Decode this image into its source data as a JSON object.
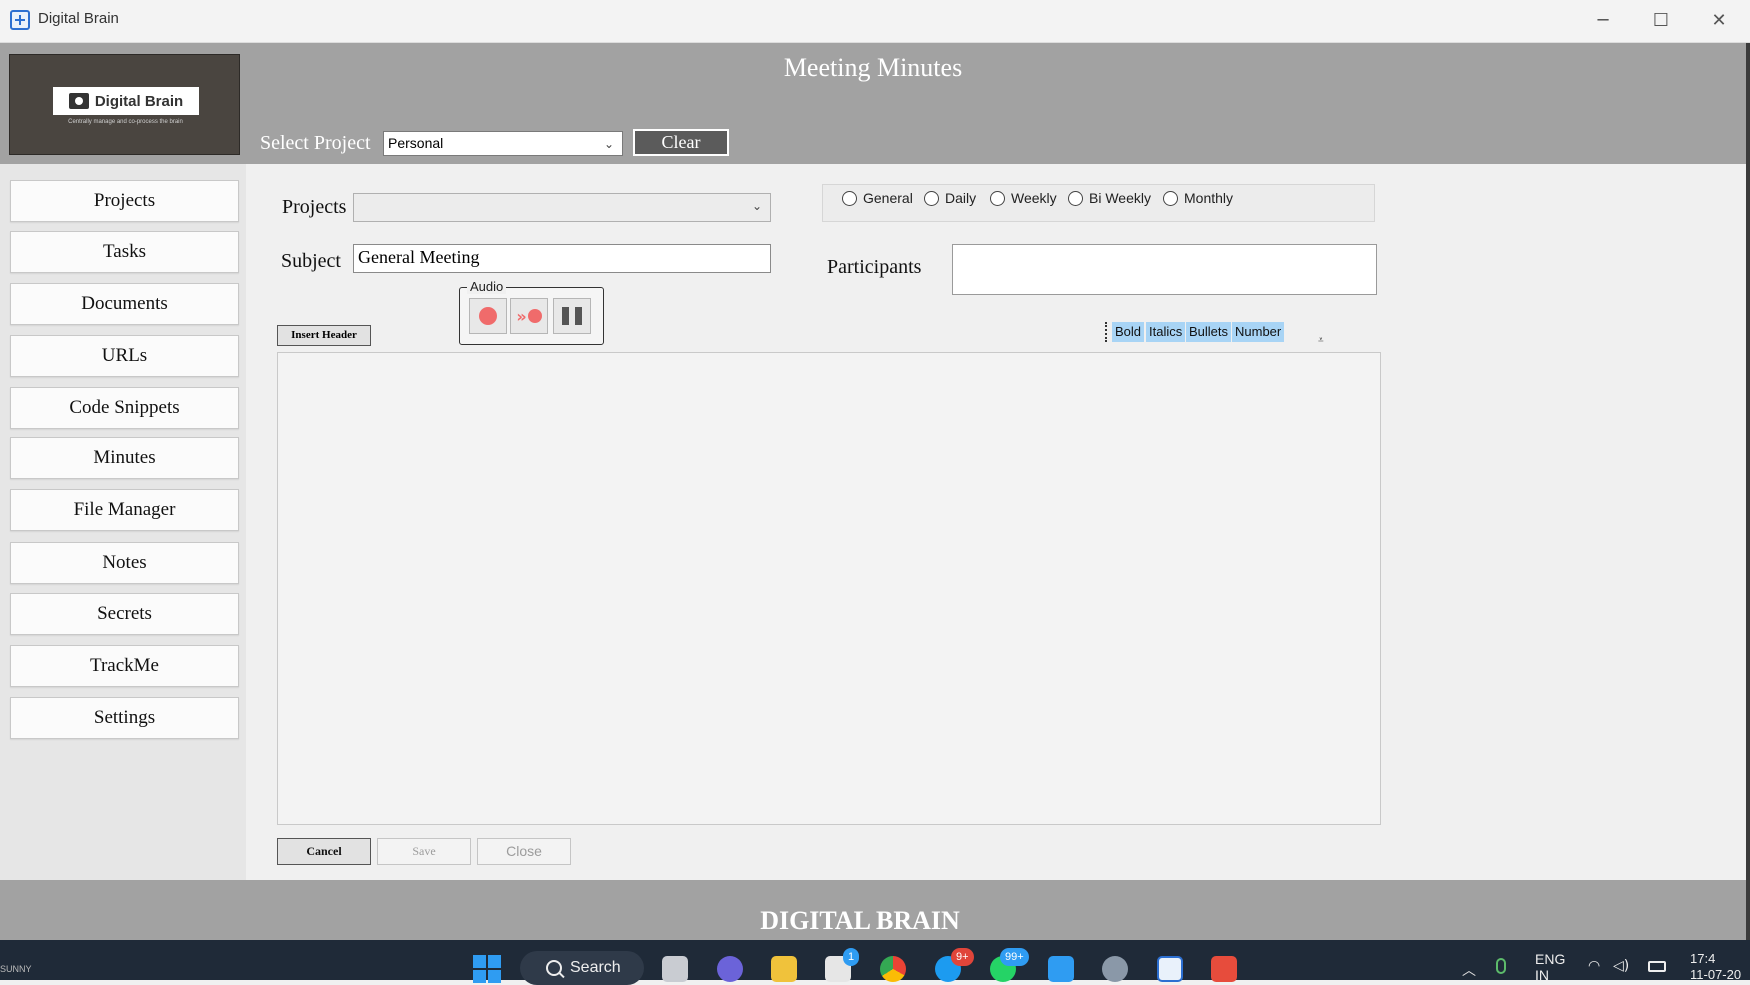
{
  "window": {
    "title": "Digital Brain"
  },
  "window_controls": {
    "minimize": "─",
    "maximize": "☐",
    "close": "✕"
  },
  "header": {
    "logo_text": "Digital Brain",
    "logo_tagline": "Centrally manage and co-process the brain",
    "page_title": "Meeting Minutes",
    "select_project_label": "Select Project",
    "select_project_value": "Personal",
    "clear_label": "Clear"
  },
  "sidebar": {
    "items": [
      {
        "label": "Projects"
      },
      {
        "label": "Tasks"
      },
      {
        "label": "Documents"
      },
      {
        "label": "URLs"
      },
      {
        "label": "Code Snippets"
      },
      {
        "label": "Minutes"
      },
      {
        "label": "File Manager"
      },
      {
        "label": "Notes"
      },
      {
        "label": "Secrets"
      },
      {
        "label": "TrackMe"
      },
      {
        "label": "Settings"
      }
    ]
  },
  "form": {
    "projects_label": "Projects",
    "projects_value": "",
    "subject_label": "Subject",
    "subject_value": "General Meeting",
    "participants_label": "Participants",
    "participants_value": "",
    "frequency_options": [
      "General",
      "Daily",
      "Weekly",
      "Bi Weekly",
      "Monthly"
    ],
    "audio_label": "Audio",
    "insert_header_label": "Insert Header",
    "format_buttons": [
      "Bold",
      "Italics",
      "Bullets",
      "Number"
    ],
    "editor_content": "",
    "cancel_label": "Cancel",
    "save_label": "Save",
    "close_label": "Close"
  },
  "footer": {
    "brand": "DIGITAL BRAIN"
  },
  "taskbar": {
    "search_label": "Search",
    "badges": {
      "store": "1",
      "skype": "9+",
      "whatsapp": "99+"
    },
    "lang_line1": "ENG",
    "lang_line2": "IN",
    "time": "17:4",
    "date": "11-07-20",
    "user_hint": "SUNNY"
  },
  "colors": {
    "header_band": "#a2a2a2",
    "clear_button": "#5b5b5b",
    "format_button": "#a8d4f5",
    "record_red": "#f06b6b",
    "taskbar": "#1f2a38"
  },
  "icons": [
    "app-icon",
    "minimize-icon",
    "maximize-icon",
    "close-icon",
    "chevron-down-icon",
    "record-icon",
    "skip-record-icon",
    "pause-icon",
    "windows-start-icon",
    "search-icon"
  ]
}
